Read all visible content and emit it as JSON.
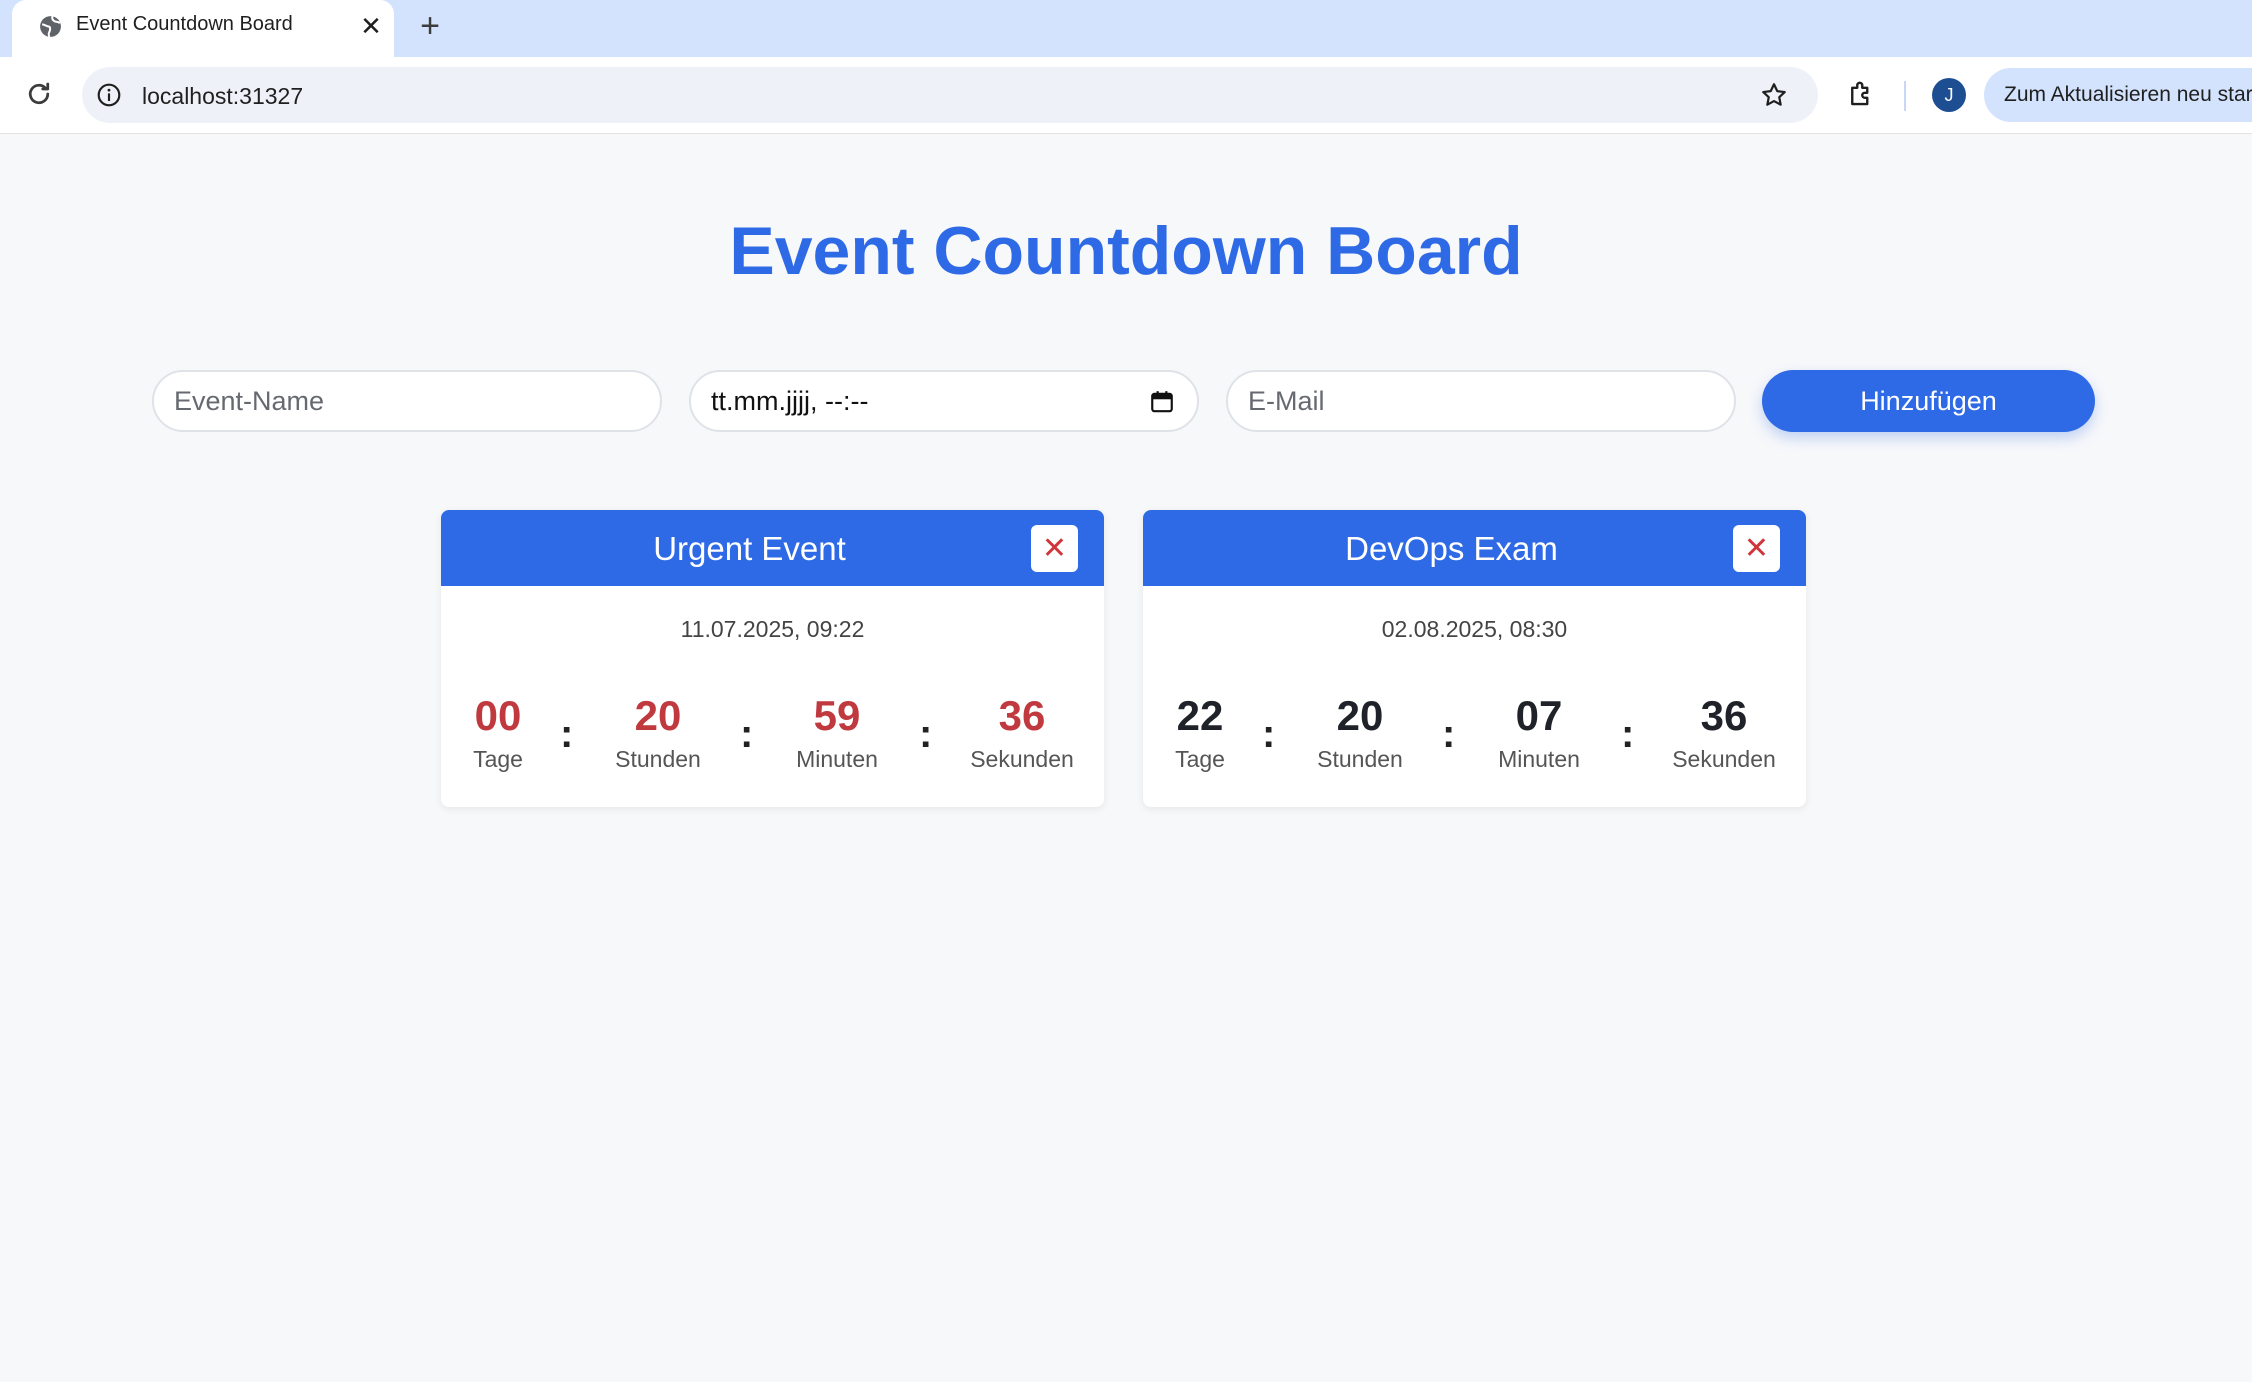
{
  "browser": {
    "tab_title": "Event Countdown Board",
    "tab_close": "✕",
    "new_tab": "+",
    "url": "localhost:31327",
    "profile_initial": "J",
    "update_label": "Zum Aktualisieren neu starten"
  },
  "page": {
    "title": "Event Countdown Board"
  },
  "form": {
    "name_placeholder": "Event-Name",
    "datetime_value": "tt.mm.jjjj, --:--",
    "email_placeholder": "E-Mail",
    "add_label": "Hinzufügen"
  },
  "units": {
    "days": "Tage",
    "hours": "Stunden",
    "minutes": "Minuten",
    "seconds": "Sekunden"
  },
  "events": [
    {
      "title": "Urgent Event",
      "date": "11.07.2025, 09:22",
      "days": "00",
      "hours": "20",
      "minutes": "59",
      "seconds": "36",
      "remove": "✕"
    },
    {
      "title": "DevOps Exam",
      "date": "02.08.2025, 08:30",
      "days": "22",
      "hours": "20",
      "minutes": "07",
      "seconds": "36",
      "remove": "✕"
    }
  ],
  "colors": {
    "accent": "#2f6ae6",
    "urgent": "#c0393f",
    "background": "#f7f8fa"
  }
}
